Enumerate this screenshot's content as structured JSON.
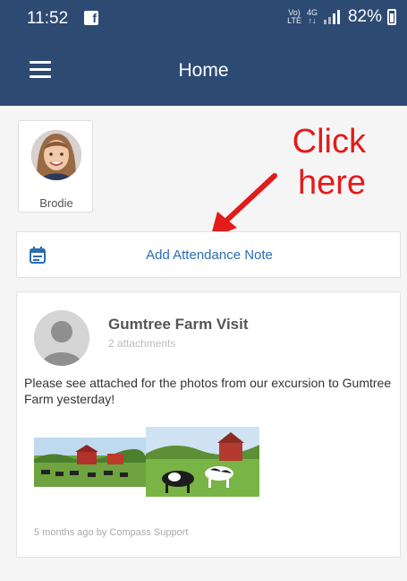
{
  "status_bar": {
    "time": "11:52",
    "lte_label_top": "Vo)",
    "lte_label_bottom": "LTE",
    "net_label_top": "4G",
    "net_label_bottom": "↑↓",
    "battery": "82%",
    "icons": [
      "facebook-icon",
      "signal-icon",
      "battery-icon"
    ]
  },
  "app_bar": {
    "title": "Home",
    "menu_icon": "hamburger-menu-icon"
  },
  "student": {
    "name": "Brodie"
  },
  "annotation": {
    "line1": "Click",
    "line2": "here",
    "color": "#e31b1b"
  },
  "attendance": {
    "label": "Add Attendance Note",
    "icon": "calendar-icon"
  },
  "news_item": {
    "title": "Gumtree Farm Visit",
    "subtitle": "2 attachments",
    "body": "Please see attached for the photos from our excursion to Gumtree Farm yesterday!",
    "footer": "5 months ago by Compass Support"
  },
  "colors": {
    "primary": "#2d4a73",
    "link": "#2b6db0",
    "background": "#f5f5f5"
  }
}
